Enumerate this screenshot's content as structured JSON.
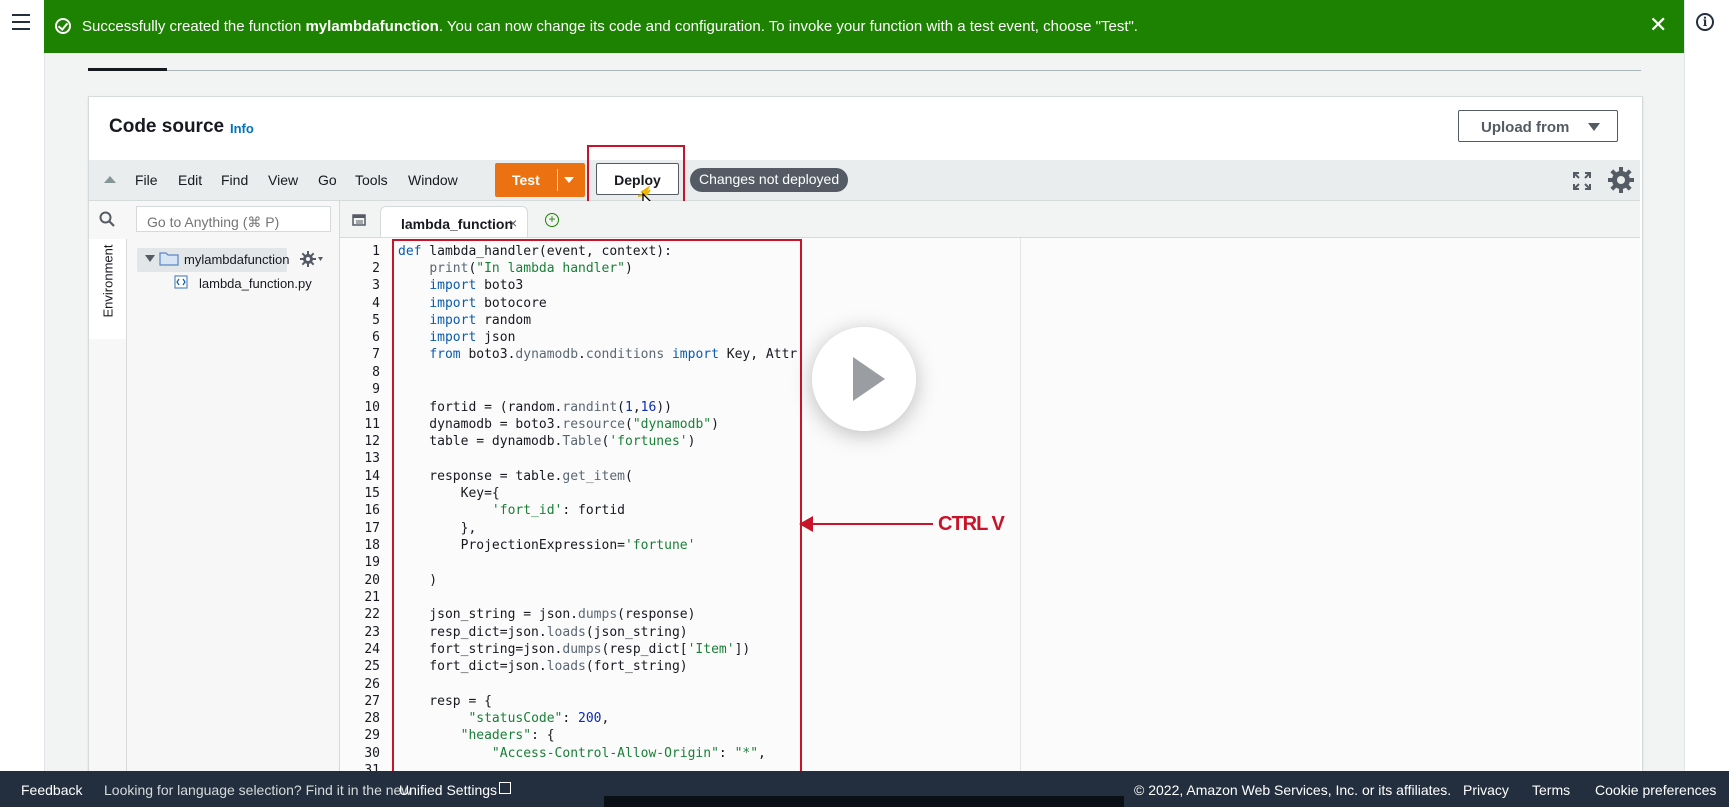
{
  "flash": {
    "prefix": "Successfully created the function ",
    "function_name": "mylambdafunction",
    "suffix": ". You can now change its code and configuration. To invoke your function with a test event, choose \"Test\".",
    "close": "✕"
  },
  "code_source": {
    "title": "Code source",
    "info": "Info",
    "upload_label": "Upload from"
  },
  "ide_menu": [
    "File",
    "Edit",
    "Find",
    "View",
    "Go",
    "Tools",
    "Window"
  ],
  "toolbar": {
    "test_label": "Test",
    "deploy_label": "Deploy",
    "status_badge": "Changes not deployed"
  },
  "sidebar": {
    "search_placeholder": "Go to Anything (⌘ P)",
    "environment_label": "Environment",
    "folder": "mylambdafunction",
    "file": "lambda_function.py"
  },
  "editor": {
    "tab_label": "lambda_function",
    "tab_close": "×",
    "line_numbers": [
      "1",
      "2",
      "3",
      "4",
      "5",
      "6",
      "7",
      "8",
      "9",
      "10",
      "11",
      "12",
      "13",
      "14",
      "15",
      "16",
      "17",
      "18",
      "19",
      "20",
      "21",
      "22",
      "23",
      "24",
      "25",
      "26",
      "27",
      "28",
      "29",
      "30",
      "31"
    ]
  },
  "annotation": {
    "label": "CTRL V"
  },
  "footer": {
    "feedback": "Feedback",
    "language_notice": "Looking for language selection? Find it in the new ",
    "unified_settings": "Unified Settings",
    "copyright": "© 2022, Amazon Web Services, Inc. or its affiliates.",
    "privacy": "Privacy",
    "terms": "Terms",
    "cookie": "Cookie preferences"
  },
  "colors": {
    "success_green": "#1d8102",
    "test_orange": "#ec7211",
    "annotation_red": "#c7142a",
    "footer_navy": "#232f3e"
  }
}
